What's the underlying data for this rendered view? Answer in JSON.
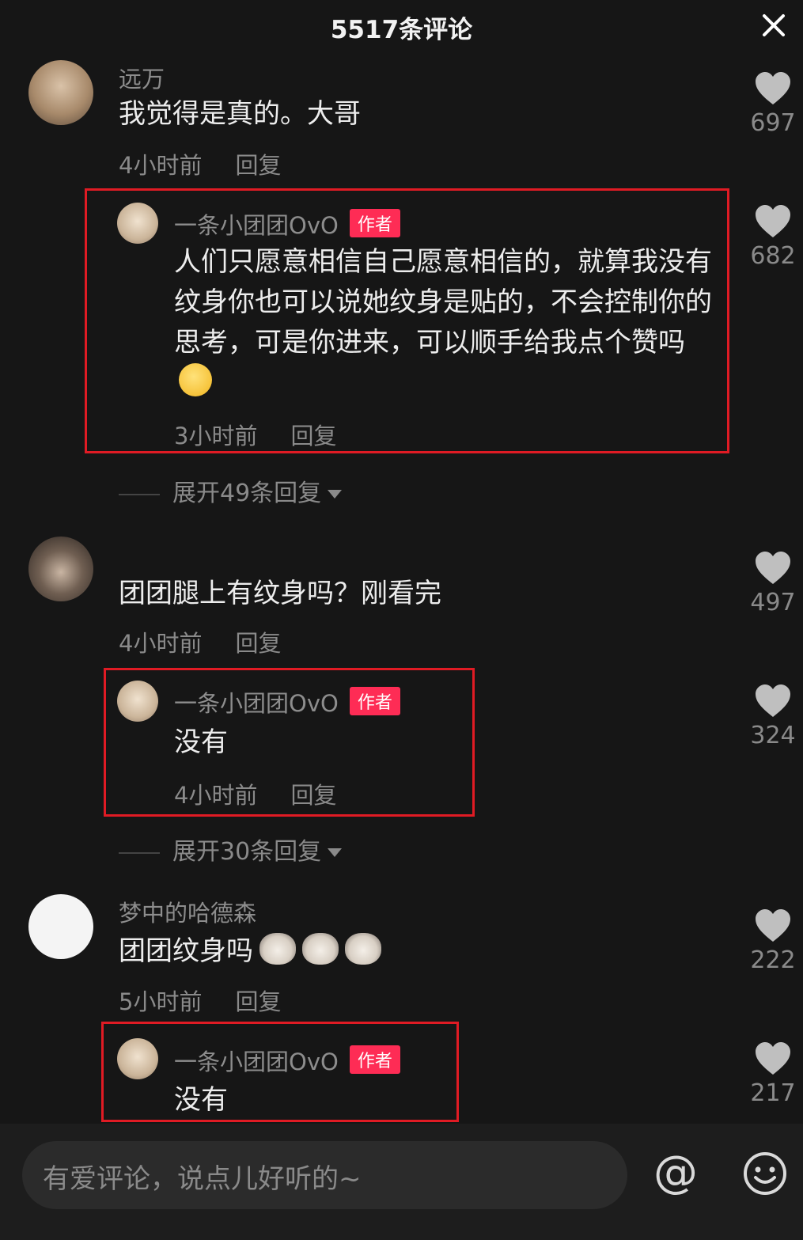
{
  "header": {
    "title": "5517条评论"
  },
  "comments": [
    {
      "user": "远万",
      "text": "我觉得是真的。大哥",
      "time": "4小时前",
      "reply": "回复",
      "likes": "697",
      "author_reply": {
        "user": "一条小团团OvO",
        "badge": "作者",
        "text": "人们只愿意相信自己愿意相信的，就算我没有纹身你也可以说她纹身是贴的，不会控制你的思考，可是你进来，可以顺手给我点个赞吗",
        "time": "3小时前",
        "reply": "回复",
        "likes": "682"
      },
      "expand": "展开49条回复"
    },
    {
      "user": "",
      "text": "团团腿上有纹身吗？刚看完",
      "time": "4小时前",
      "reply": "回复",
      "likes": "497",
      "author_reply": {
        "user": "一条小团团OvO",
        "badge": "作者",
        "text": "没有",
        "time": "4小时前",
        "reply": "回复",
        "likes": "324"
      },
      "expand": "展开30条回复"
    },
    {
      "user": "梦中的哈德森",
      "text": "团团纹身吗",
      "time": "5小时前",
      "reply": "回复",
      "likes": "222",
      "author_reply": {
        "user": "一条小团团OvO",
        "badge": "作者",
        "text": "没有",
        "likes": "217"
      }
    }
  ],
  "input": {
    "placeholder": "有爱评论，说点儿好听的~"
  },
  "icons": {
    "close": "close-icon",
    "like": "heart-icon",
    "at": "at-icon",
    "emoji": "emoji-icon"
  },
  "colors": {
    "background": "#161616",
    "badge": "#fe2c55",
    "highlight": "#e01b24",
    "secondary_text": "#8a8a8a"
  }
}
